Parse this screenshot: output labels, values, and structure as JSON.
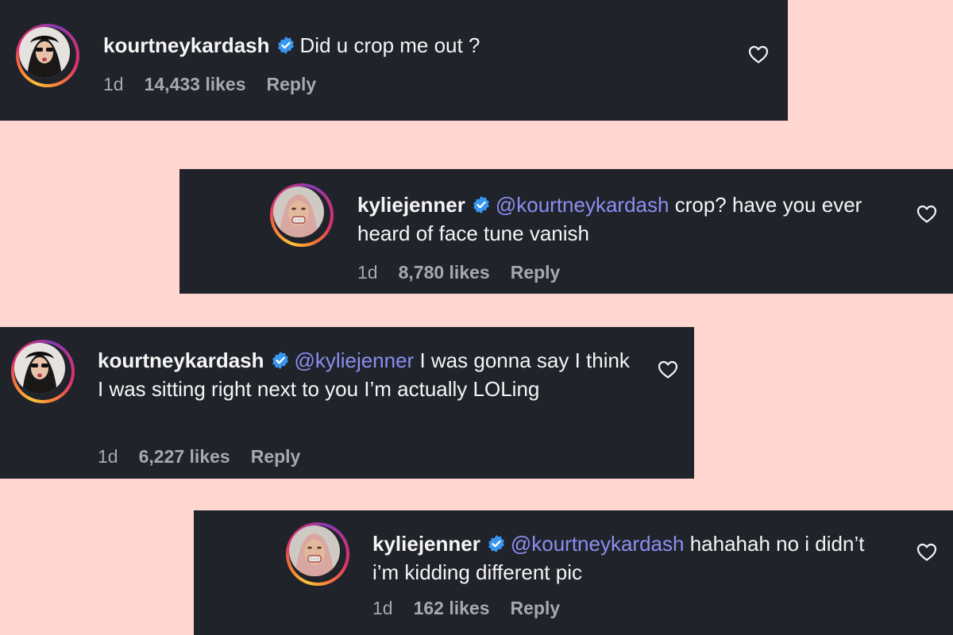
{
  "colors": {
    "background": "#ffd6d0",
    "card": "#21232b",
    "mention": "#8b8ff0",
    "verified": "#3897f0"
  },
  "comments": [
    {
      "username": "kourtneykardash",
      "mention": "",
      "text": "Did u crop me out ?",
      "time": "1d",
      "likes": "14,433 likes",
      "reply": "Reply",
      "icon": "heart-outline"
    },
    {
      "username": "kyliejenner",
      "mention": "@kourtneykardash",
      "text": "crop? have you ever heard of face tune vanish",
      "time": "1d",
      "likes": "8,780 likes",
      "reply": "Reply",
      "icon": "heart-outline"
    },
    {
      "username": "kourtneykardash",
      "mention": "@kyliejenner",
      "text": "I was gonna say I think I was sitting right next to you I’m actually LOLing",
      "time": "1d",
      "likes": "6,227 likes",
      "reply": "Reply",
      "icon": "heart-outline"
    },
    {
      "username": "kyliejenner",
      "mention": "@kourtneykardash",
      "text": "hahahah no i didn’t i’m kidding different pic",
      "time": "1d",
      "likes": "162 likes",
      "reply": "Reply",
      "icon": "heart-outline"
    }
  ]
}
